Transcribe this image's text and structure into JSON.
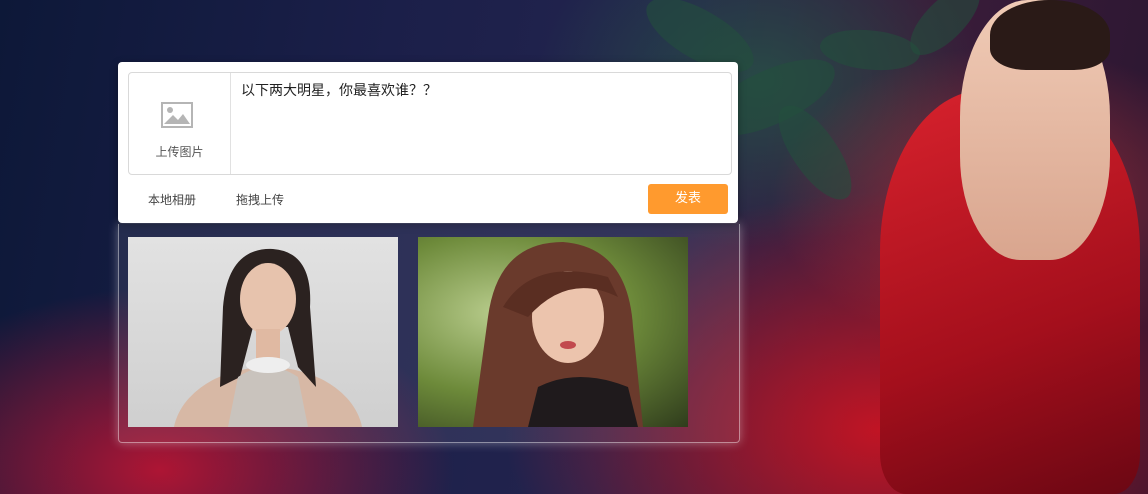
{
  "composer": {
    "upload_image_label": "上传图片",
    "post_text": "以下两大明星，你最喜欢谁？？",
    "local_album_label": "本地相册",
    "drag_upload_label": "拖拽上传",
    "publish_label": "发表"
  },
  "icons": {
    "upload": "image-icon"
  },
  "colors": {
    "publish_button": "#ff9a2e"
  }
}
